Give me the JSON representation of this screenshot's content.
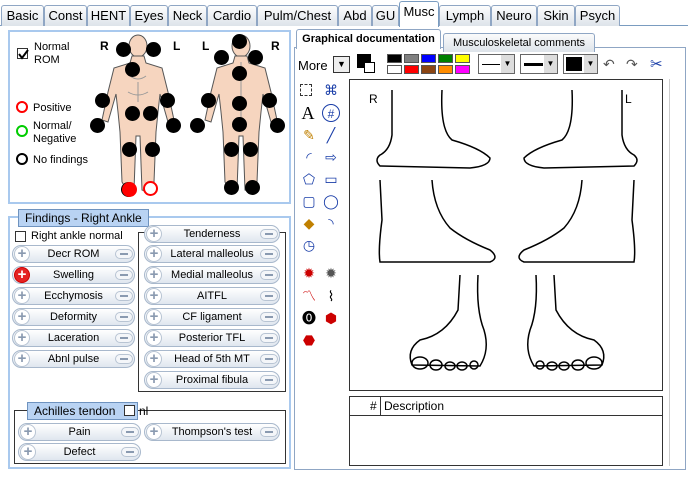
{
  "tabs": [
    {
      "label": "Basic"
    },
    {
      "label": "Const"
    },
    {
      "label": "HENT"
    },
    {
      "label": "Eyes"
    },
    {
      "label": "Neck"
    },
    {
      "label": "Cardio"
    },
    {
      "label": "Pulm/Chest"
    },
    {
      "label": "Abd"
    },
    {
      "label": "GU"
    },
    {
      "label": "Musc"
    },
    {
      "label": "Lymph"
    },
    {
      "label": "Neuro"
    },
    {
      "label": "Skin"
    },
    {
      "label": "Psych"
    }
  ],
  "body_map": {
    "normal_rom": "Normal ROM",
    "side_r": "R",
    "side_l": "L",
    "legend": {
      "positive": "Positive",
      "normal_negative": "Normal/ Negative",
      "no_findings": "No findings"
    }
  },
  "findings": {
    "title": "Findings - Right Ankle",
    "normal_label": "Right ankle normal",
    "left_items": [
      {
        "label": "Decr ROM",
        "state": "none"
      },
      {
        "label": "Swelling",
        "state": "positive"
      },
      {
        "label": "Ecchymosis",
        "state": "none"
      },
      {
        "label": "Deformity",
        "state": "none"
      },
      {
        "label": "Laceration",
        "state": "none"
      },
      {
        "label": "Abnl pulse",
        "state": "none"
      }
    ],
    "tenderness_items": [
      {
        "label": "Tenderness"
      },
      {
        "label": "Lateral malleolus"
      },
      {
        "label": "Medial malleolus"
      },
      {
        "label": "AITFL"
      },
      {
        "label": "CF ligament"
      },
      {
        "label": "Posterior TFL"
      },
      {
        "label": "Head of 5th MT"
      },
      {
        "label": "Proximal fibula"
      }
    ]
  },
  "achilles": {
    "title": "Achilles tendon",
    "nl_label": "nl",
    "items": [
      {
        "label": "Pain"
      },
      {
        "label": "Thompson's test"
      },
      {
        "label": "Defect"
      }
    ]
  },
  "graphical": {
    "tab_active": "Graphical documentation",
    "tab_inactive": "Musculoskeletal comments",
    "more_label": "More",
    "side_r": "R",
    "side_l": "L",
    "colors": [
      "#000000",
      "#ffffff",
      "#808080",
      "#ff0000",
      "#0000ff",
      "#008000",
      "#ffff00",
      "#ff00ff",
      "#00aa00",
      "#8b4513",
      "#ff8c00"
    ],
    "table_header": {
      "num": "#",
      "description": "Description"
    }
  }
}
